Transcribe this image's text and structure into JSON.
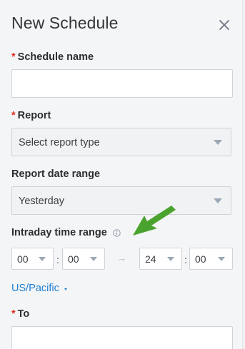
{
  "dialog": {
    "title": "New Schedule"
  },
  "form": {
    "schedule_name": {
      "required_mark": "*",
      "label": "Schedule name",
      "value": ""
    },
    "report": {
      "required_mark": "*",
      "label": "Report",
      "selected": "Select report type"
    },
    "report_date_range": {
      "label": "Report date range",
      "selected": "Yesterday"
    },
    "intraday_time_range": {
      "label": "Intraday time range",
      "start_hour": "00",
      "start_minute": "00",
      "separator": ":",
      "arrow": "→",
      "end_hour": "24",
      "end_minute": "00"
    },
    "timezone": {
      "label": "US/Pacific"
    },
    "to": {
      "required_mark": "*",
      "label": "To",
      "value": ""
    }
  },
  "colors": {
    "required": "#d93025",
    "link": "#1e7fd0",
    "annotation_arrow": "#4aa32e"
  },
  "icons": {
    "close": "close-icon",
    "info": "info-icon",
    "dropdown": "chevron-down-icon",
    "annotation": "green-arrow-annotation"
  }
}
